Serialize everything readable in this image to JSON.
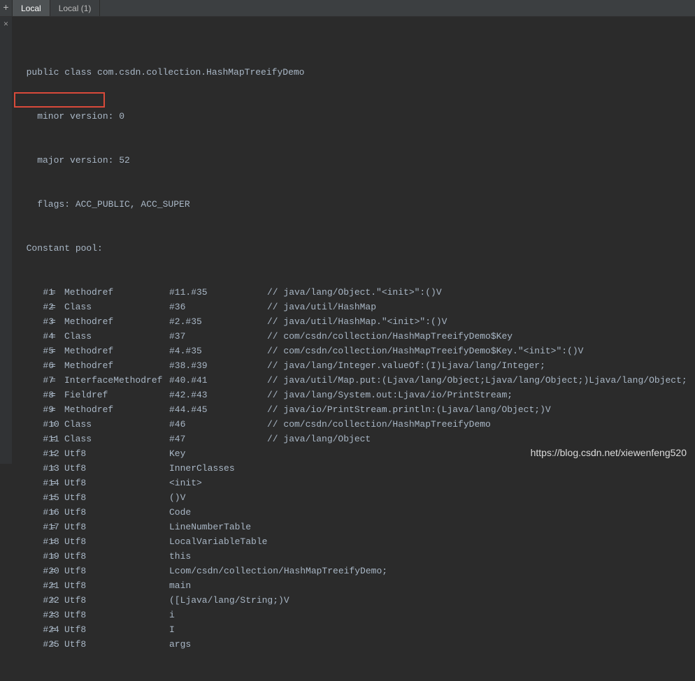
{
  "tabs": {
    "plus": "+",
    "tab1": "Local",
    "tab2": "Local (1)"
  },
  "gutter": {
    "close": "×"
  },
  "header": {
    "l1": "  public class com.csdn.collection.HashMapTreeifyDemo",
    "l2": "    minor version: 0",
    "l3": "    major version: 52",
    "l4": "    flags: ACC_PUBLIC, ACC_SUPER",
    "l5": "  Constant pool:"
  },
  "pool": [
    {
      "idx": "#1",
      "type": "Methodref",
      "ref": "#11.#35",
      "cmt": "// java/lang/Object.\"<init>\":()V"
    },
    {
      "idx": "#2",
      "type": "Class",
      "ref": "#36",
      "cmt": "// java/util/HashMap"
    },
    {
      "idx": "#3",
      "type": "Methodref",
      "ref": "#2.#35",
      "cmt": "// java/util/HashMap.\"<init>\":()V"
    },
    {
      "idx": "#4",
      "type": "Class",
      "ref": "#37",
      "cmt": "// com/csdn/collection/HashMapTreeifyDemo$Key"
    },
    {
      "idx": "#5",
      "type": "Methodref",
      "ref": "#4.#35",
      "cmt": "// com/csdn/collection/HashMapTreeifyDemo$Key.\"<init>\":()V"
    },
    {
      "idx": "#6",
      "type": "Methodref",
      "ref": "#38.#39",
      "cmt": "// java/lang/Integer.valueOf:(I)Ljava/lang/Integer;"
    },
    {
      "idx": "#7",
      "type": "InterfaceMethodref",
      "ref": "#40.#41",
      "cmt": "// java/util/Map.put:(Ljava/lang/Object;Ljava/lang/Object;)Ljava/lang/Object;"
    },
    {
      "idx": "#8",
      "type": "Fieldref",
      "ref": "#42.#43",
      "cmt": "// java/lang/System.out:Ljava/io/PrintStream;"
    },
    {
      "idx": "#9",
      "type": "Methodref",
      "ref": "#44.#45",
      "cmt": "// java/io/PrintStream.println:(Ljava/lang/Object;)V"
    },
    {
      "idx": "#10",
      "type": "Class",
      "ref": "#46",
      "cmt": "// com/csdn/collection/HashMapTreeifyDemo"
    },
    {
      "idx": "#11",
      "type": "Class",
      "ref": "#47",
      "cmt": "// java/lang/Object"
    },
    {
      "idx": "#12",
      "type": "Utf8",
      "ref": "Key",
      "cmt": ""
    },
    {
      "idx": "#13",
      "type": "Utf8",
      "ref": "InnerClasses",
      "cmt": ""
    },
    {
      "idx": "#14",
      "type": "Utf8",
      "ref": "<init>",
      "cmt": ""
    },
    {
      "idx": "#15",
      "type": "Utf8",
      "ref": "()V",
      "cmt": ""
    },
    {
      "idx": "#16",
      "type": "Utf8",
      "ref": "Code",
      "cmt": ""
    },
    {
      "idx": "#17",
      "type": "Utf8",
      "ref": "LineNumberTable",
      "cmt": ""
    },
    {
      "idx": "#18",
      "type": "Utf8",
      "ref": "LocalVariableTable",
      "cmt": ""
    },
    {
      "idx": "#19",
      "type": "Utf8",
      "ref": "this",
      "cmt": ""
    },
    {
      "idx": "#20",
      "type": "Utf8",
      "ref": "Lcom/csdn/collection/HashMapTreeifyDemo;",
      "cmt": ""
    },
    {
      "idx": "#21",
      "type": "Utf8",
      "ref": "main",
      "cmt": ""
    },
    {
      "idx": "#22",
      "type": "Utf8",
      "ref": "([Ljava/lang/String;)V",
      "cmt": ""
    },
    {
      "idx": "#23",
      "type": "Utf8",
      "ref": "i",
      "cmt": ""
    },
    {
      "idx": "#24",
      "type": "Utf8",
      "ref": "I",
      "cmt": ""
    },
    {
      "idx": "#25",
      "type": "Utf8",
      "ref": "args",
      "cmt": ""
    }
  ],
  "watermark": "https://blog.csdn.net/xiewenfeng520"
}
